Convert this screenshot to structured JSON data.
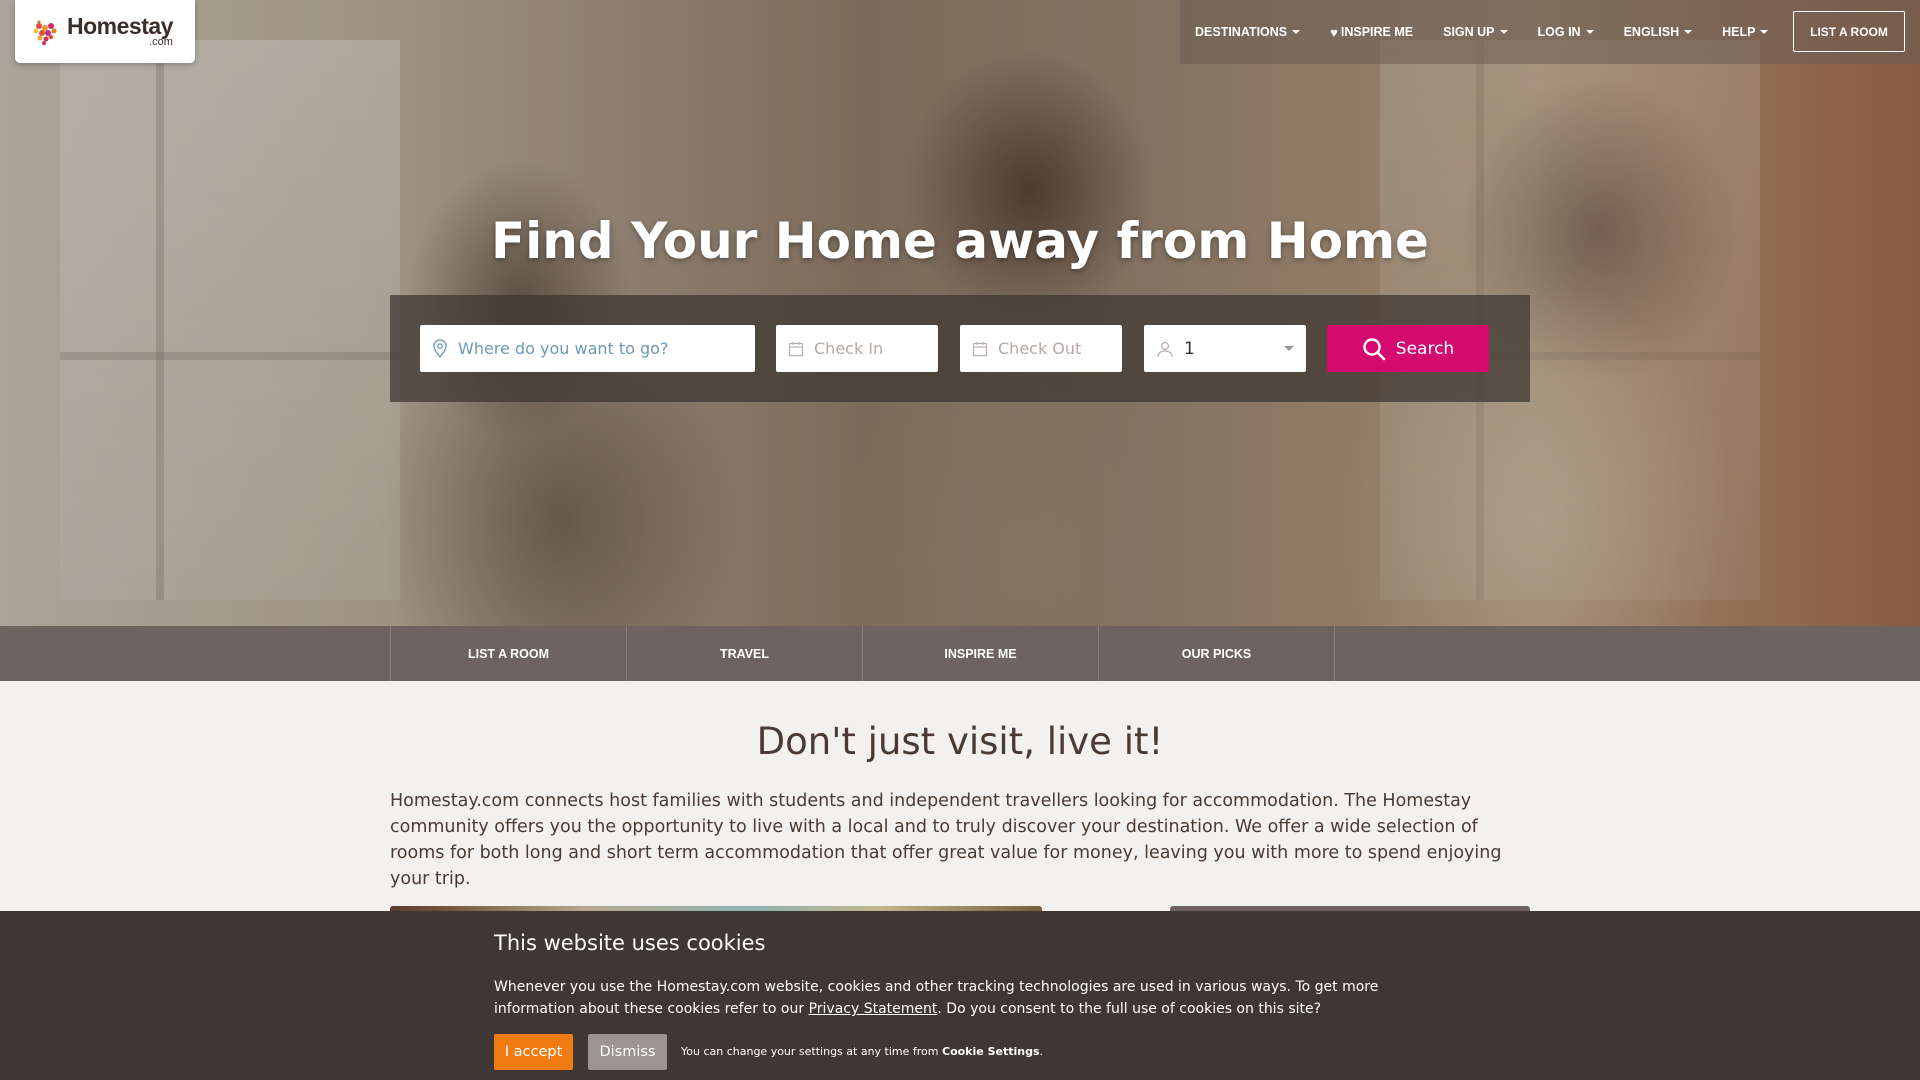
{
  "brand": {
    "name": "Homestay",
    "suffix": ".com"
  },
  "topnav": {
    "items": [
      {
        "label": "DESTINATIONS",
        "dropdown": true
      },
      {
        "label": "INSPIRE ME",
        "icon": "heart-icon"
      },
      {
        "label": "SIGN UP",
        "dropdown": true
      },
      {
        "label": "LOG IN",
        "dropdown": true
      },
      {
        "label": "ENGLISH",
        "dropdown": true
      },
      {
        "label": "HELP",
        "dropdown": true
      }
    ],
    "cta": "LIST A ROOM"
  },
  "hero": {
    "headline": "Find Your Home away from Home"
  },
  "search": {
    "where_placeholder": "Where do you want to go?",
    "checkin_placeholder": "Check In",
    "checkout_placeholder": "Check Out",
    "guests_value": "1",
    "button_label": "Search",
    "button_color": "#d40a6f"
  },
  "subnav": {
    "items": [
      "LIST A ROOM",
      "TRAVEL",
      "INSPIRE ME",
      "OUR PICKS"
    ]
  },
  "content": {
    "title": "Don't just visit, live it!",
    "body": "Homestay.com connects host families with students and independent travellers looking for accommodation. The Homestay community offers you the opportunity to live with a local and to truly discover your destination. We offer a wide selection of rooms for both long and short term accommodation that offer great value for money, leaving you with more to spend enjoying your trip."
  },
  "cookie": {
    "title": "This website uses cookies",
    "text_before_link": "Whenever you use the Homestay.com website, cookies and other tracking technologies are used in various ways. To get more information about these cookies refer to our ",
    "link_text": "Privacy Statement",
    "text_after_link": ". Do you consent to the full use of cookies on this site?",
    "accept_label": "I accept",
    "dismiss_label": "Dismiss",
    "note_prefix": "You can change your settings at any time from ",
    "note_link": "Cookie Settings",
    "note_suffix": ".",
    "accept_color": "#ef7c13"
  }
}
